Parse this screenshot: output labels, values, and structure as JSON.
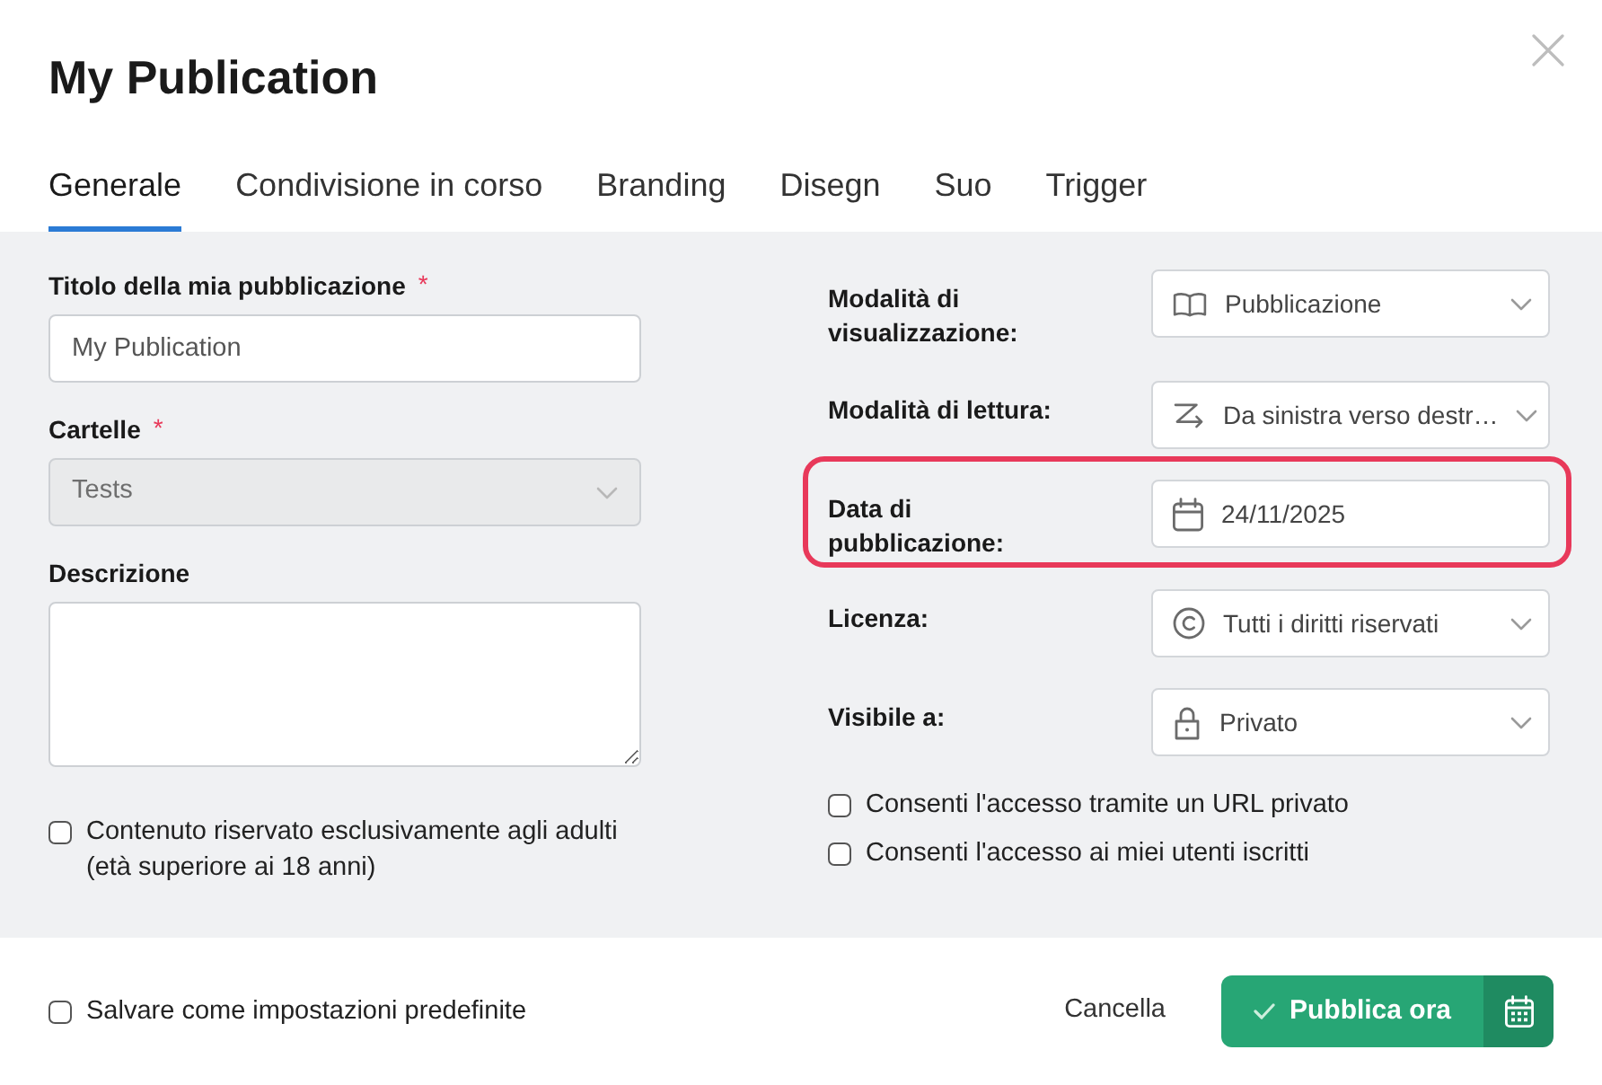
{
  "dialog": {
    "title": "My Publication"
  },
  "tabs": [
    {
      "label": "Generale",
      "selected": true
    },
    {
      "label": "Condivisione in corso",
      "selected": false
    },
    {
      "label": "Branding",
      "selected": false
    },
    {
      "label": "Disegn",
      "selected": false
    },
    {
      "label": "Suo",
      "selected": false
    },
    {
      "label": "Trigger",
      "selected": false
    }
  ],
  "left_fields": [
    {
      "kind": "input",
      "label": "Titolo della mia pubblicazione",
      "required_mark": "*",
      "value": "My Publication",
      "disabled": false
    },
    {
      "kind": "select",
      "label": "Cartelle",
      "required_mark": "*",
      "value": "Tests",
      "disabled": true
    },
    {
      "kind": "textarea",
      "label": "Descrizione",
      "disabled": false
    }
  ],
  "adult_option": {
    "label": "Contenuto riservato esclusivamente agli adulti (età superiore ai 18 anni)",
    "checked": false
  },
  "right_fields": [
    {
      "kind": "select",
      "label": "Modalità di visualizzazione:",
      "value": "Pubblicazione",
      "highlighted": false
    },
    {
      "kind": "select",
      "label": "Modalità di lettura:",
      "value": "Da sinistra verso destr…",
      "highlighted": false
    },
    {
      "kind": "date",
      "label": "Data di pubblicazione:",
      "value": "24/11/2025",
      "highlighted": true
    },
    {
      "kind": "select",
      "label": "Licenza:",
      "value": "Tutti i diritti riservati",
      "highlighted": false
    },
    {
      "kind": "select",
      "label": "Visibile a:",
      "value": "Privato",
      "highlighted": false
    }
  ],
  "access_options": [
    {
      "label": "Consenti l'accesso tramite un URL privato",
      "checked": false
    },
    {
      "label": "Consenti l'accesso ai miei utenti iscritti",
      "checked": false
    }
  ],
  "footer": {
    "save_default": {
      "label": "Salvare come impostazioni predefinite",
      "checked": false
    },
    "cancel": "Cancella",
    "publish": "Pubblica ora"
  }
}
